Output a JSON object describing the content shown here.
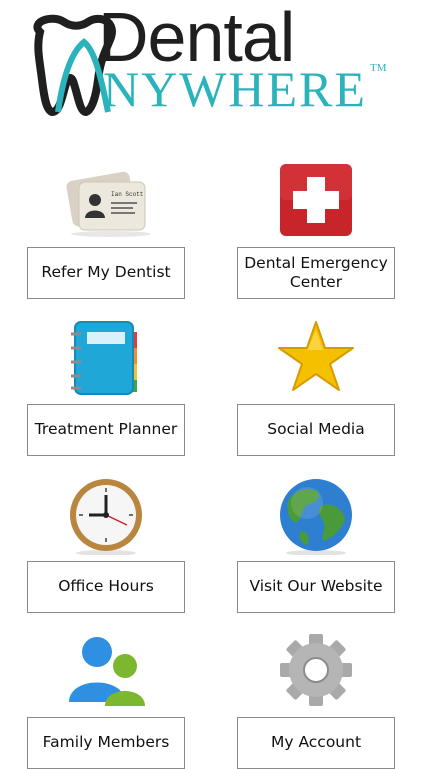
{
  "brand": {
    "name_top": "Dental",
    "name_bottom": "NYWHERE",
    "trademark": "TM"
  },
  "menu": [
    {
      "label": "Refer My Dentist",
      "icon": "business-cards-icon",
      "card_text": "Ian Scott"
    },
    {
      "label": "Dental Emergency Center",
      "icon": "first-aid-cross-icon"
    },
    {
      "label": "Treatment Planner",
      "icon": "planner-notebook-icon"
    },
    {
      "label": "Social Media",
      "icon": "star-icon"
    },
    {
      "label": "Office Hours",
      "icon": "clock-icon"
    },
    {
      "label": "Visit Our Website",
      "icon": "globe-icon"
    },
    {
      "label": "Family Members",
      "icon": "family-members-icon"
    },
    {
      "label": "My Account",
      "icon": "gear-icon"
    }
  ],
  "colors": {
    "accent": "#2bb3bc",
    "logo_dark": "#1f1f1f",
    "emergency_red": "#c8252b",
    "star_yellow": "#f5c000"
  }
}
